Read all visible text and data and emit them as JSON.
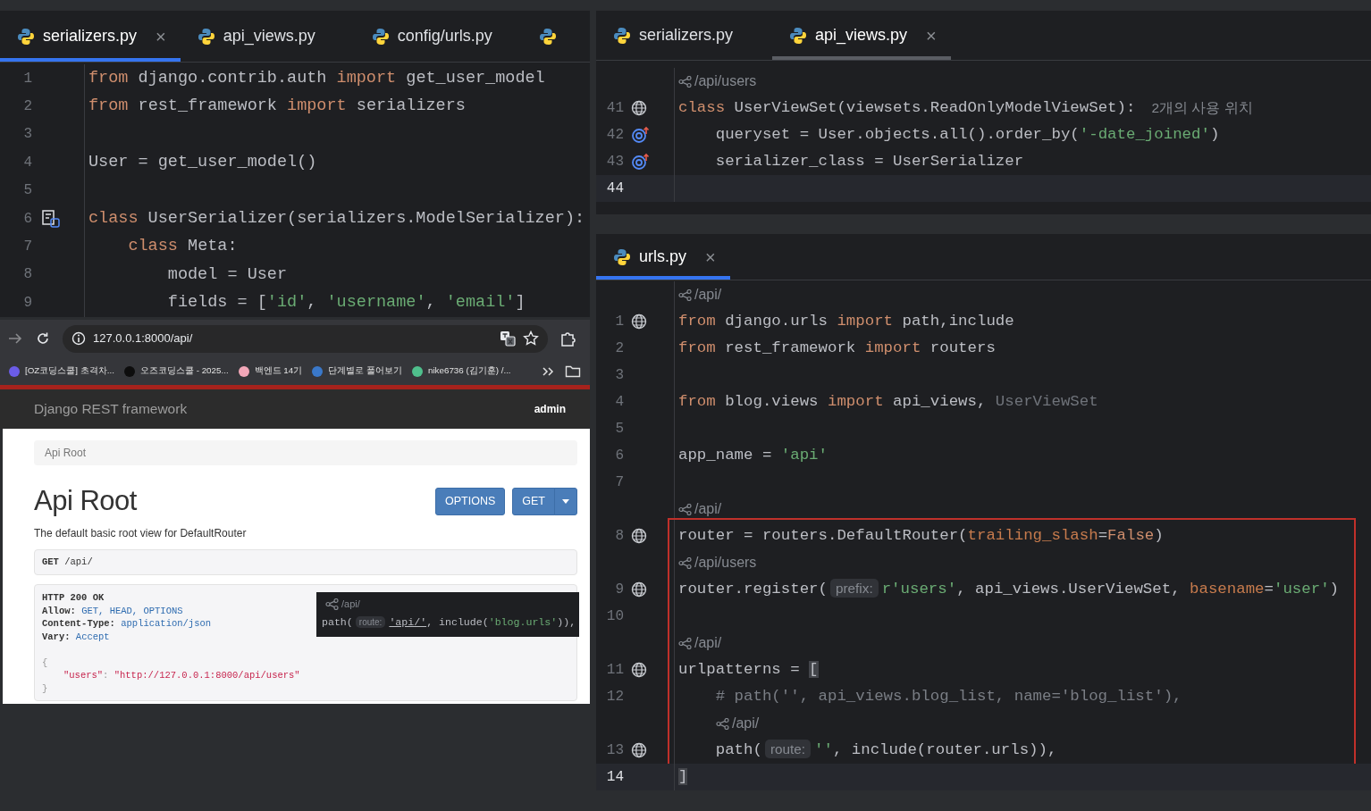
{
  "left_editor": {
    "focused": true,
    "cut_tab": true,
    "tabs": [
      {
        "label": "serializers.py",
        "selected": true,
        "close": "×"
      },
      {
        "label": "api_views.py",
        "selected": false
      },
      {
        "label": "config/urls.py",
        "selected": false
      }
    ],
    "lines": [
      {
        "number": "1",
        "tokens": [
          {
            "kind": "kw",
            "text": "from"
          },
          {
            "kind": "plain",
            "text": " django.contrib.auth "
          },
          {
            "kind": "kw",
            "text": "import"
          },
          {
            "kind": "plain",
            "text": " get_user_model"
          }
        ]
      },
      {
        "number": "2",
        "tokens": [
          {
            "kind": "kw",
            "text": "from"
          },
          {
            "kind": "plain",
            "text": " rest_framework "
          },
          {
            "kind": "kw",
            "text": "import"
          },
          {
            "kind": "plain",
            "text": " serializers"
          }
        ]
      },
      {
        "number": "3"
      },
      {
        "number": "4",
        "tokens": [
          {
            "kind": "plain",
            "text": "User = get_user_model()"
          }
        ]
      },
      {
        "number": "5"
      },
      {
        "number": "6",
        "kind": "model-class",
        "tokens": [
          {
            "kind": "kw",
            "text": "class"
          },
          {
            "kind": "plain",
            "text": " UserSerializer(serializers.ModelSerializer):"
          }
        ]
      },
      {
        "number": "7",
        "tokens": [
          {
            "kind": "kw",
            "text": "    class"
          },
          {
            "kind": "plain",
            "text": " Meta:"
          }
        ]
      },
      {
        "number": "8",
        "tokens": [
          {
            "kind": "plain",
            "text": "        model = User"
          }
        ]
      },
      {
        "number": "9",
        "tokens": [
          {
            "kind": "plain",
            "text": "        fields = ["
          },
          {
            "kind": "str",
            "text": "'id'"
          },
          {
            "kind": "plain",
            "text": ", "
          },
          {
            "kind": "str",
            "text": "'username'"
          },
          {
            "kind": "plain",
            "text": ", "
          },
          {
            "kind": "str",
            "text": "'email'"
          },
          {
            "kind": "plain",
            "text": "]"
          }
        ]
      }
    ]
  },
  "browser": {
    "url": "127.0.0.1:8000/api/",
    "bookmarks": [
      {
        "label": "[OZ코딩스쿨] 초격차...",
        "color": "#6b5ce7"
      },
      {
        "label": "오즈코딩스쿨 - 2025...",
        "color": "#0d0d0d"
      },
      {
        "label": "백엔드 14기",
        "color": "#f2a7b8"
      },
      {
        "label": "단계별로 풀어보기",
        "color": "#3a78c9"
      },
      {
        "label": "nike6736 (김기훈) /...",
        "color": "#4fbf8c"
      }
    ],
    "navbar": {
      "brand": "Django REST framework",
      "user": "admin"
    },
    "breadcrumb": "Api Root",
    "title": "Api Root",
    "buttons": [
      {
        "label": "OPTIONS",
        "kind": "plain"
      },
      {
        "label": "GET",
        "kind": "split"
      }
    ],
    "description": "The default basic root view for DefaultRouter",
    "request": {
      "method": "GET",
      "path": "/api/"
    },
    "response": {
      "status": "HTTP 200 OK",
      "headers": [
        {
          "name": "Allow:",
          "value": "GET, HEAD, OPTIONS"
        },
        {
          "name": "Content-Type:",
          "value": "application/json"
        },
        {
          "name": "Vary:",
          "value": "Accept"
        }
      ],
      "body": [
        {
          "kind": "brace",
          "text": "{"
        },
        {
          "kind": "pair",
          "key": "\"users\"",
          "sep": ":",
          "value": "\"http://127.0.0.1:8000/api/users\""
        },
        {
          "kind": "brace",
          "text": "}"
        }
      ]
    },
    "popup": {
      "route": "/api/",
      "tokens": [
        {
          "kind": "plain",
          "text": "path("
        },
        {
          "kind": "hint",
          "text": "route:"
        },
        {
          "kind": "link",
          "text": "'api/'"
        },
        {
          "kind": "plain",
          "text": ", include("
        },
        {
          "kind": "str",
          "text": "'blog.urls'"
        },
        {
          "kind": "plain",
          "text": ")),"
        }
      ]
    }
  },
  "right_top_editor": {
    "focused": false,
    "tabs": [
      {
        "label": "serializers.py",
        "selected": false
      },
      {
        "label": "api_views.py",
        "selected": true,
        "close": "×"
      }
    ],
    "lines": [
      {
        "kind": "route",
        "text": "/api/users"
      },
      {
        "number": "41",
        "kind": "endpoint",
        "current": false,
        "tokens": [
          {
            "kind": "kw",
            "text": "class"
          },
          {
            "kind": "plain",
            "text": " UserViewSet(viewsets.ReadOnlyModelViewSet):"
          },
          {
            "kind": "usage",
            "text": "2개의 사용 위치"
          }
        ]
      },
      {
        "number": "42",
        "kind": "override",
        "current": false,
        "tokens": [
          {
            "kind": "plain",
            "text": "    queryset = User.objects.all().order_by("
          },
          {
            "kind": "str",
            "text": "'-date_joined'"
          },
          {
            "kind": "plain",
            "text": ")"
          }
        ]
      },
      {
        "number": "43",
        "kind": "override",
        "current": false,
        "tokens": [
          {
            "kind": "plain",
            "text": "    serializer_class = UserSerializer"
          }
        ]
      },
      {
        "number": "44",
        "current": true
      }
    ]
  },
  "right_bottom_editor": {
    "focused": true,
    "tabs": [
      {
        "label": "urls.py",
        "selected": true,
        "close": "×"
      }
    ],
    "blocks": [
      {
        "boxed": false,
        "lines": [
          {
            "kind": "route",
            "text": "/api/"
          },
          {
            "number": "1",
            "kind": "endpoint",
            "current": false,
            "tokens": [
              {
                "kind": "kw",
                "text": "from"
              },
              {
                "kind": "plain",
                "text": " django.urls "
              },
              {
                "kind": "kw",
                "text": "import"
              },
              {
                "kind": "plain",
                "text": " path,include"
              }
            ]
          },
          {
            "number": "2",
            "current": false,
            "tokens": [
              {
                "kind": "kw",
                "text": "from"
              },
              {
                "kind": "plain",
                "text": " rest_framework "
              },
              {
                "kind": "kw",
                "text": "import"
              },
              {
                "kind": "plain",
                "text": " routers"
              }
            ]
          },
          {
            "number": "3",
            "current": false
          },
          {
            "number": "4",
            "current": false,
            "tokens": [
              {
                "kind": "kw",
                "text": "from"
              },
              {
                "kind": "plain",
                "text": " blog.views "
              },
              {
                "kind": "kw",
                "text": "import"
              },
              {
                "kind": "plain",
                "text": " api_views, "
              },
              {
                "kind": "dim",
                "text": "UserViewSet"
              }
            ]
          },
          {
            "number": "5",
            "current": false
          },
          {
            "number": "6",
            "current": false,
            "tokens": [
              {
                "kind": "plain",
                "text": "app_name = "
              },
              {
                "kind": "str",
                "text": "'api'"
              }
            ]
          },
          {
            "number": "7",
            "current": false
          },
          {
            "kind": "route",
            "text": "/api/"
          }
        ]
      },
      {
        "boxed": true,
        "lines": [
          {
            "number": "8",
            "kind": "endpoint",
            "current": false,
            "tokens": [
              {
                "kind": "plain",
                "text": "router = routers.DefaultRouter("
              },
              {
                "kind": "param",
                "text": "trailing_slash"
              },
              {
                "kind": "plain",
                "text": "="
              },
              {
                "kind": "kw",
                "text": "False"
              },
              {
                "kind": "plain",
                "text": ")"
              }
            ]
          },
          {
            "kind": "route",
            "text": "/api/users"
          },
          {
            "number": "9",
            "kind": "endpoint",
            "current": false,
            "tokens": [
              {
                "kind": "plain",
                "text": "router.register("
              },
              {
                "kind": "hint",
                "text": "prefix:"
              },
              {
                "kind": "str",
                "text": "r'users'"
              },
              {
                "kind": "plain",
                "text": ", api_views.UserViewSet, "
              },
              {
                "kind": "param",
                "text": "basename"
              },
              {
                "kind": "plain",
                "text": "="
              },
              {
                "kind": "str",
                "text": "'user'"
              },
              {
                "kind": "plain",
                "text": ")"
              }
            ]
          },
          {
            "number": "10",
            "current": false
          },
          {
            "kind": "route",
            "text": "/api/"
          },
          {
            "number": "11",
            "kind": "endpoint",
            "current": false,
            "tokens": [
              {
                "kind": "plain",
                "text": "urlpatterns = "
              },
              {
                "kind": "brace",
                "text": "["
              }
            ]
          },
          {
            "number": "12",
            "current": false,
            "tokens": [
              {
                "kind": "comment",
                "text": "    # path('', api_views.blog_list, name='blog_list'),"
              }
            ]
          },
          {
            "kind": "route",
            "text": "/api/",
            "nested": true
          },
          {
            "number": "13",
            "kind": "endpoint",
            "current": false,
            "tokens": [
              {
                "kind": "plain",
                "text": "    path("
              },
              {
                "kind": "hint",
                "text": "route:"
              },
              {
                "kind": "str",
                "text": "''"
              },
              {
                "kind": "plain",
                "text": ", include(router.urls)),"
              }
            ]
          }
        ]
      },
      {
        "boxed": false,
        "lines": [
          {
            "number": "14",
            "current": true,
            "tokens": [
              {
                "kind": "brace",
                "text": "]"
              }
            ]
          }
        ]
      }
    ]
  }
}
